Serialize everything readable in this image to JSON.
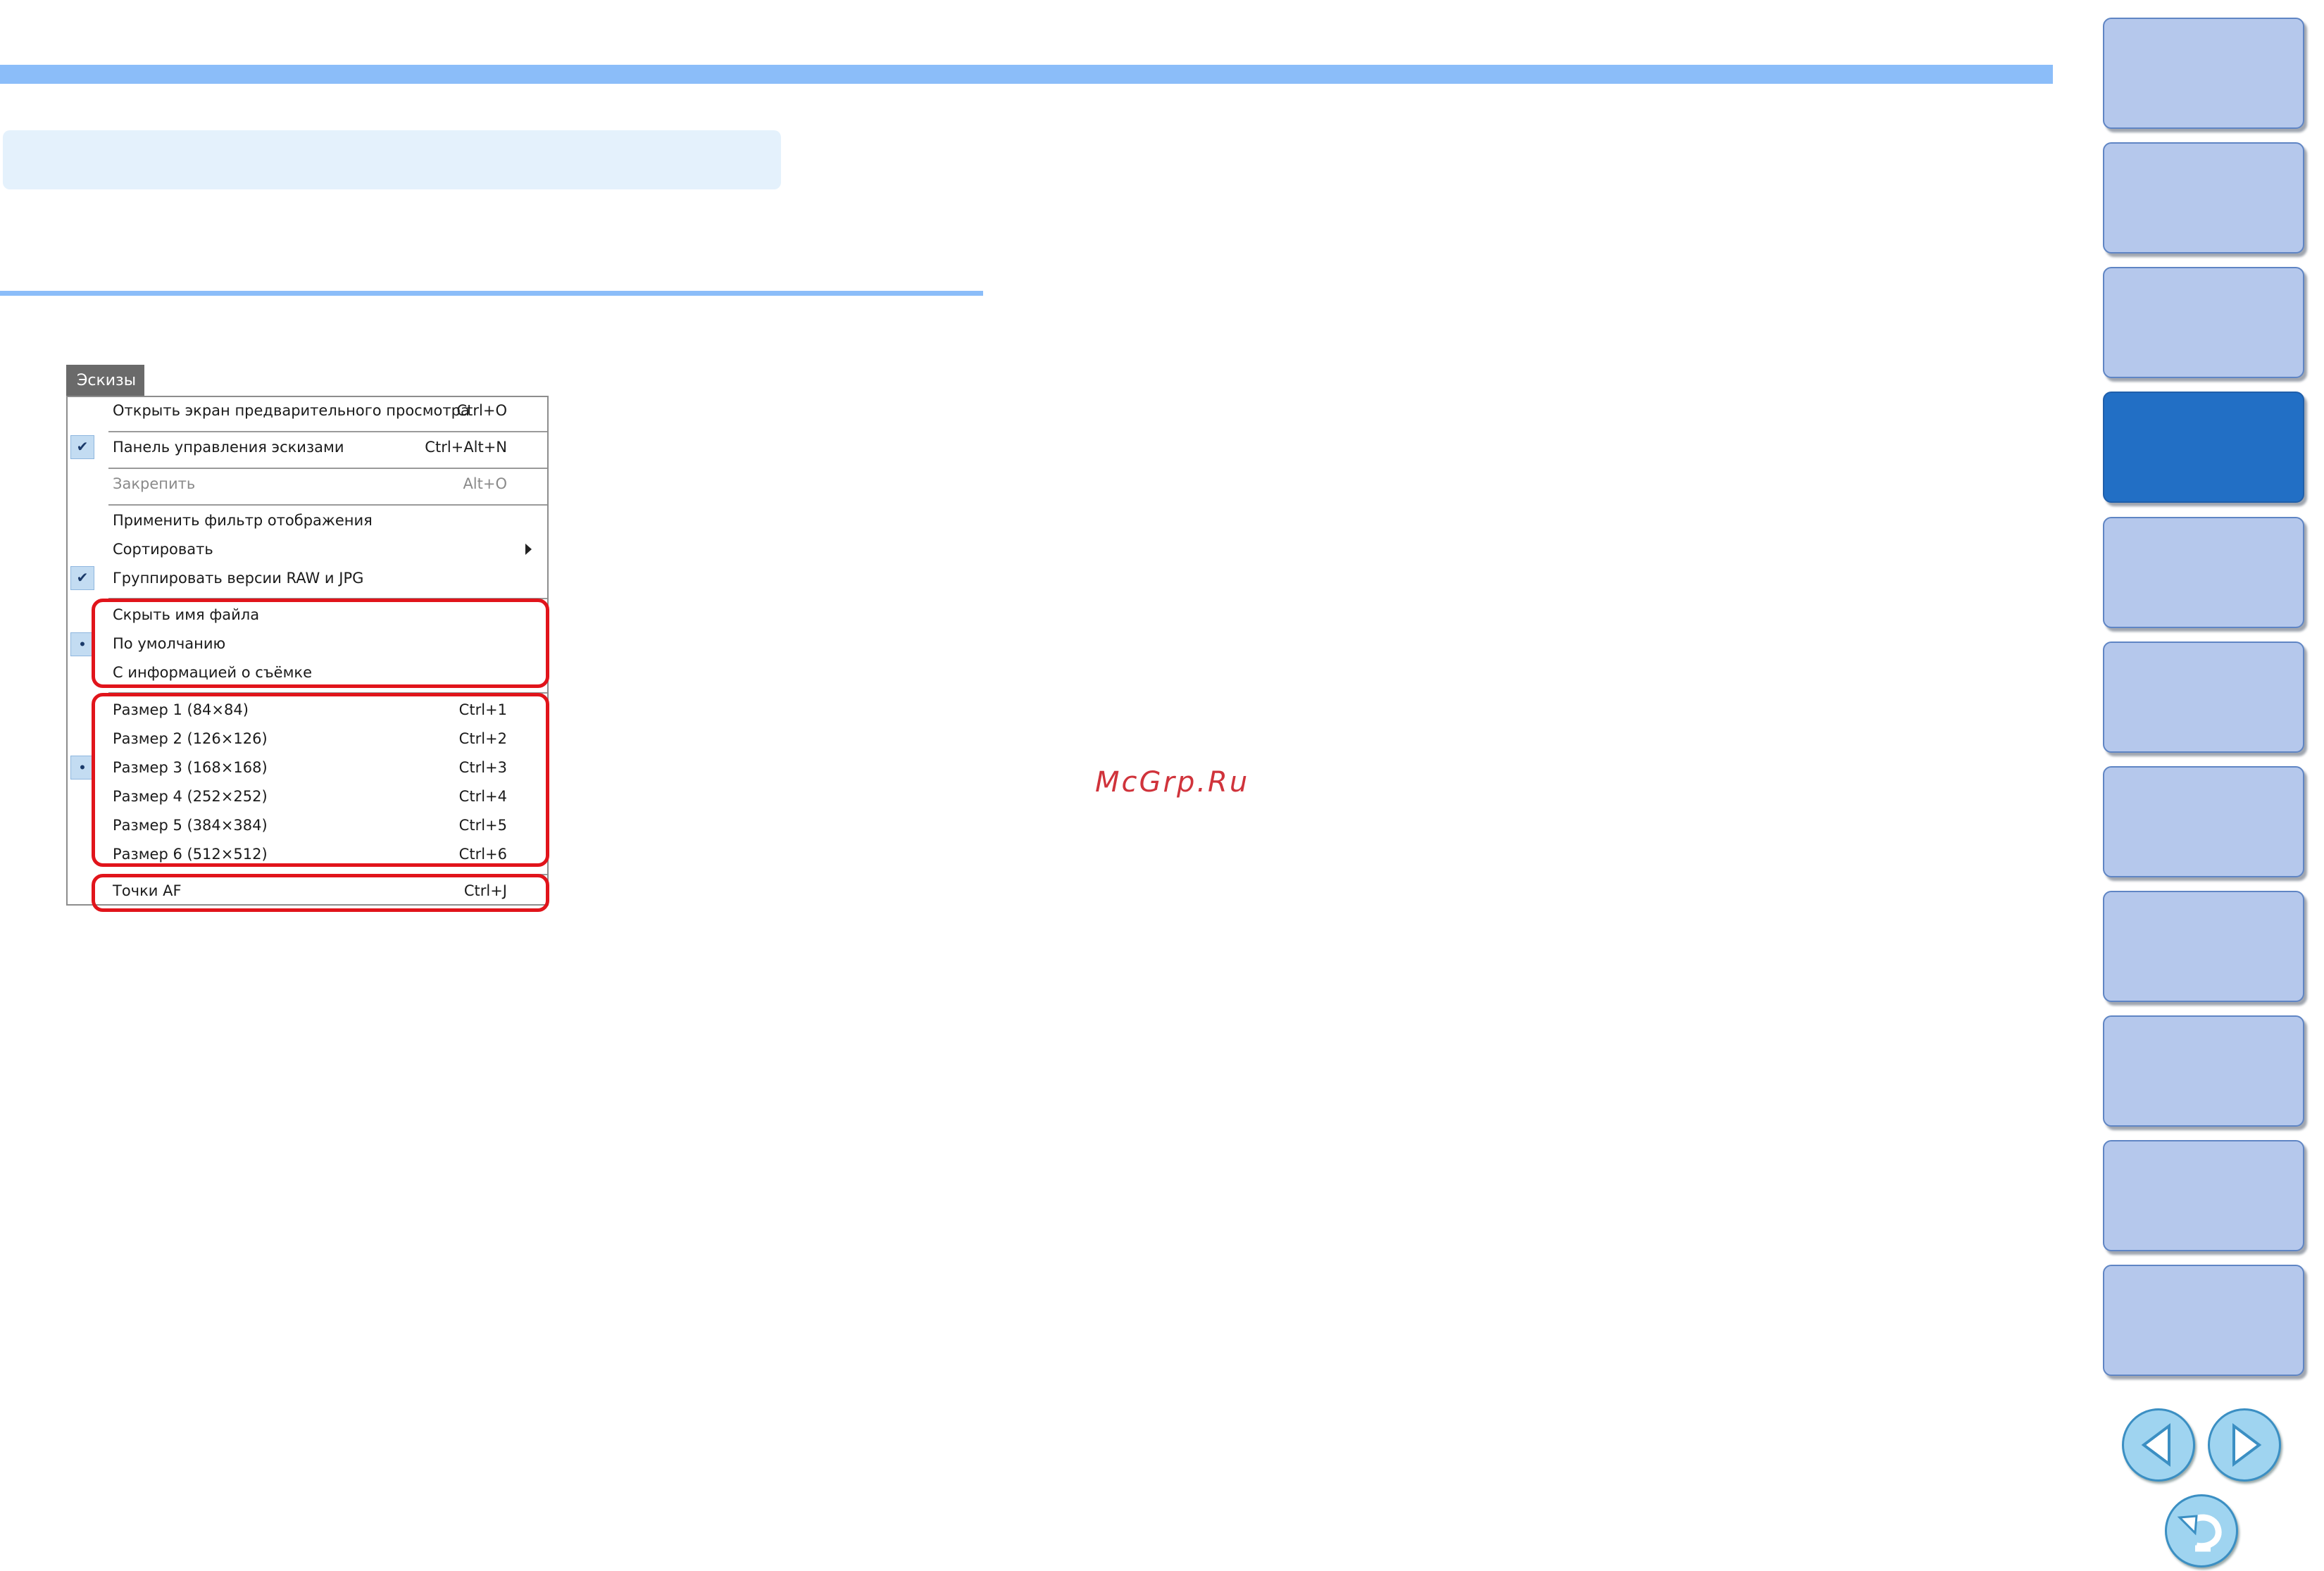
{
  "watermark": "McGrp.Ru",
  "menu": {
    "tab_label": "Эскизы",
    "items": [
      {
        "label": "Открыть экран предварительного просмотра",
        "shortcut": "Ctrl+O"
      },
      {
        "label": "Панель управления эскизами",
        "shortcut": "Ctrl+Alt+N",
        "checked": true
      },
      {
        "label": "Закрепить",
        "shortcut": "Alt+O",
        "disabled": true
      },
      {
        "label": "Применить фильтр отображения",
        "shortcut": ""
      },
      {
        "label": "Сортировать",
        "shortcut": "",
        "submenu": true
      },
      {
        "label": "Группировать версии RAW и JPG",
        "shortcut": "",
        "checked": true
      },
      {
        "label": "Скрыть имя файла",
        "shortcut": ""
      },
      {
        "label": "По умолчанию",
        "shortcut": "",
        "selected": true
      },
      {
        "label": "С информацией о съёмке",
        "shortcut": ""
      },
      {
        "label": "Размер 1 (84×84)",
        "shortcut": "Ctrl+1"
      },
      {
        "label": "Размер 2 (126×126)",
        "shortcut": "Ctrl+2"
      },
      {
        "label": "Размер 3 (168×168)",
        "shortcut": "Ctrl+3",
        "selected": true
      },
      {
        "label": "Размер 4 (252×252)",
        "shortcut": "Ctrl+4"
      },
      {
        "label": "Размер 5 (384×384)",
        "shortcut": "Ctrl+5"
      },
      {
        "label": "Размер 6 (512×512)",
        "shortcut": "Ctrl+6"
      },
      {
        "label": "Точки AF",
        "shortcut": "Ctrl+J"
      }
    ]
  },
  "sidebar": {
    "tab_count": 11,
    "active_tab": 4
  },
  "colors": {
    "accent_bar": "#8bbdf9",
    "highlight": "#e1141b",
    "tab_active": "#226fc5",
    "tab_inactive": "#b5c8ec"
  }
}
